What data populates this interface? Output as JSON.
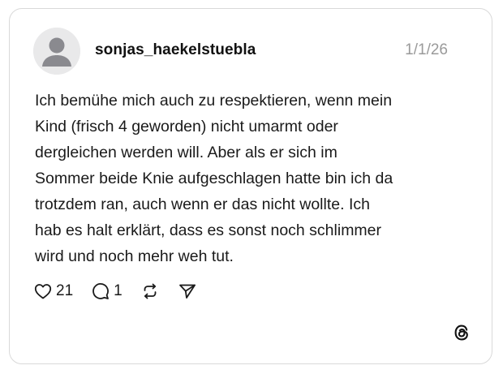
{
  "post": {
    "username": "sonjas_haekelstuebla",
    "timestamp": "1/1/26",
    "text_lines": [
      "Ich bemühe mich auch zu respektieren, wenn mein",
      "Kind (frisch 4 geworden) nicht umarmt oder",
      "dergleichen werden will. Aber als er sich im",
      "Sommer beide Knie aufgeschlagen hatte bin ich da",
      "trotzdem ran, auch wenn er das nicht wollte. Ich",
      "hab es halt erklärt, dass es sonst noch schlimmer",
      "wird und noch mehr weh tut."
    ]
  },
  "actions": {
    "likes": "21",
    "replies": "1"
  },
  "icons": {
    "avatar": "default-user-avatar",
    "like": "heart-icon",
    "reply": "comment-bubble-icon",
    "repost": "repost-arrows-icon",
    "share": "send-paper-plane-icon",
    "brand": "threads-logo-icon"
  }
}
